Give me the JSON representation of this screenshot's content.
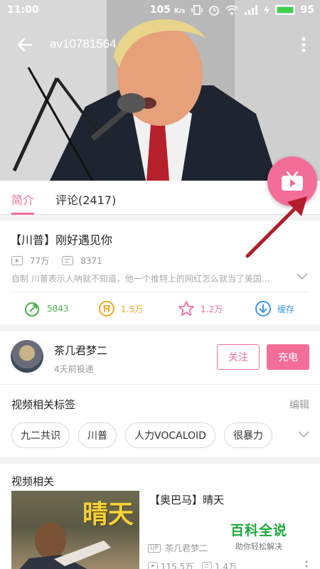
{
  "status_bar": {
    "time": "11:00",
    "speed": "105",
    "speed_unit": "K/s",
    "battery": "95"
  },
  "video": {
    "id": "av10781564"
  },
  "tabs": [
    {
      "label": "简介",
      "active": true
    },
    {
      "label": "评论(2417)",
      "active": false
    }
  ],
  "intro": {
    "title": "【川普】刚好遇见你",
    "plays": "77万",
    "danmaku": "8371",
    "description": "自制 川普表示人呐就不知道，他一个推特上的网红怎么就当了美国...",
    "actions": [
      {
        "label": "5843",
        "icon": "coin-share-icon",
        "color": "#4caf50"
      },
      {
        "label": "1.5万",
        "icon": "coin-icon",
        "color": "#f5a623"
      },
      {
        "label": "1.2万",
        "icon": "star-icon",
        "color": "#f26e99"
      },
      {
        "label": "缓存",
        "icon": "download-icon",
        "color": "#3d9ae8"
      }
    ]
  },
  "uploader": {
    "name": "茶几君梦二",
    "time": "4天前投递",
    "follow_label": "关注",
    "charge_label": "充电"
  },
  "tags_section": {
    "title": "视频相关标签",
    "edit_label": "编辑",
    "tags": [
      "九二共识",
      "川普",
      "人力VOCALOID",
      "很暴力"
    ]
  },
  "related": {
    "title": "视频相关",
    "item": {
      "name": "【奥巴马】晴天",
      "thumb_text": "晴天",
      "up": "茶几君梦二",
      "up_badge": "UP",
      "plays": "115.5万",
      "danmaku": "1.4万"
    }
  },
  "watermark": {
    "title": "百科全说",
    "subtitle": "助你轻松解决"
  },
  "colors": {
    "accent": "#f26e99",
    "green": "#1fa83a"
  }
}
